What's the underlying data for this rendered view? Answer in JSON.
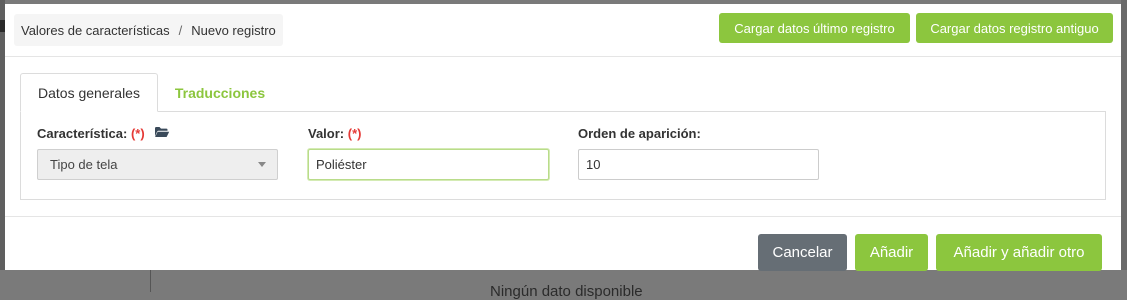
{
  "background": {
    "no_data_text": "Ningún dato disponible"
  },
  "header": {
    "breadcrumb": {
      "parent": "Valores de características",
      "separator": "/",
      "current": "Nuevo registro"
    },
    "load_last_label": "Cargar datos último registro",
    "load_old_label": "Cargar datos registro antiguo"
  },
  "tabs": [
    {
      "label": "Datos generales",
      "active": true
    },
    {
      "label": "Traducciones",
      "active": false
    }
  ],
  "form": {
    "caracteristica": {
      "label": "Característica:",
      "required_mark": "(*)",
      "value": "Tipo de tela",
      "icon": "folder-open-icon"
    },
    "valor": {
      "label": "Valor:",
      "required_mark": "(*)",
      "value": "Poliéster"
    },
    "orden": {
      "label": "Orden de aparición:",
      "value": "10"
    }
  },
  "footer": {
    "cancel_label": "Cancelar",
    "add_label": "Añadir",
    "add_other_label": "Añadir y añadir otro"
  },
  "colors": {
    "accent_green": "#8cc63e",
    "cancel_gray": "#666e75",
    "required_red": "#e53935"
  }
}
